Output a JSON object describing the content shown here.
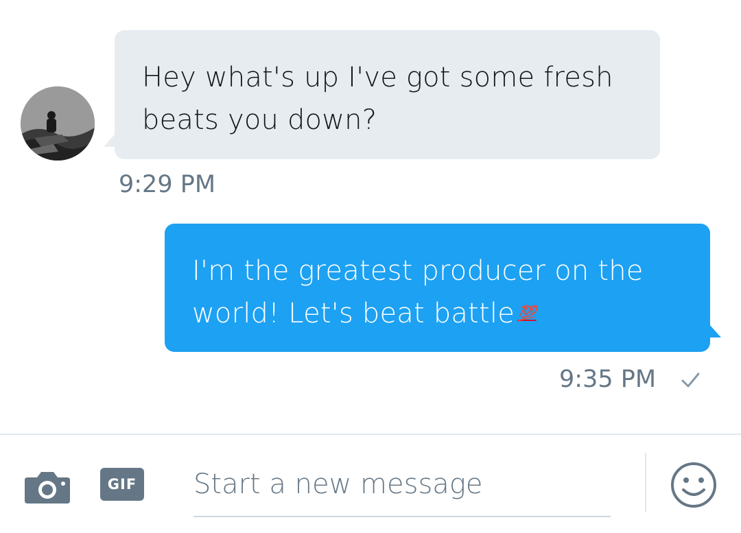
{
  "conversation": {
    "incoming": {
      "text_line1": "Hey what's up I've got some fresh",
      "text_line2": "beats you down?",
      "time": "9:29 PM",
      "avatar": "user-avatar"
    },
    "outgoing": {
      "text_line1": "I'm the greatest producer on the",
      "text_line2": "world! Let's beat battle",
      "emoji": "💯",
      "time": "9:35 PM",
      "status_icon": "check-icon"
    }
  },
  "composer": {
    "camera_icon": "camera-icon",
    "gif_label": "GIF",
    "placeholder": "Start a new message",
    "emoji_icon": "smiley-icon"
  },
  "colors": {
    "incoming_bubble": "#e6ecf0",
    "outgoing_bubble": "#1da1f2",
    "muted_text": "#657786",
    "primary_text": "#14171a"
  }
}
